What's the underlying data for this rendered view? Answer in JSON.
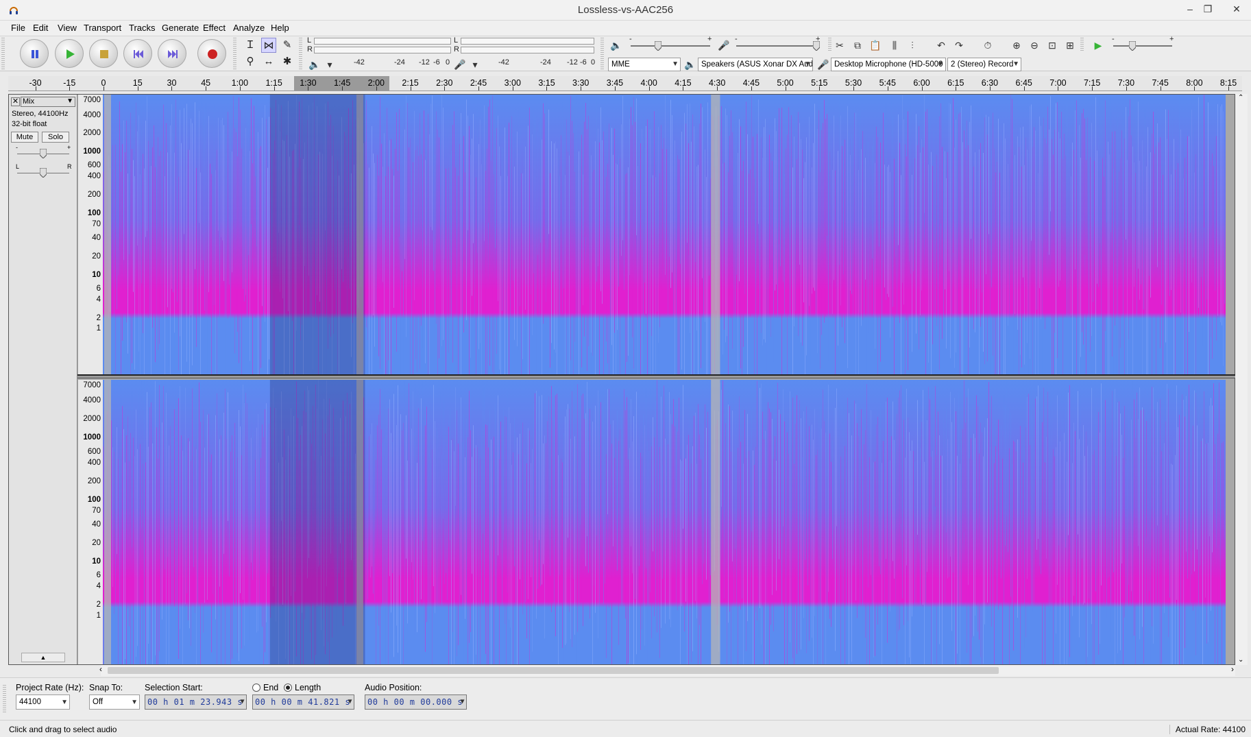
{
  "window": {
    "title": "Lossless-vs-AAC256",
    "minimize": "–",
    "maximize": "❐",
    "close": "✕"
  },
  "menu": [
    {
      "label": "File",
      "ul": "F",
      "rest": "ile"
    },
    {
      "label": "Edit",
      "ul": "E",
      "rest": "dit"
    },
    {
      "label": "View",
      "ul": "V",
      "rest": "iew"
    },
    {
      "label": "Transport",
      "ul": "T",
      "rest": "ransport"
    },
    {
      "label": "Tracks",
      "ul": "T",
      "rest": "racks"
    },
    {
      "label": "Generate",
      "ul": "G",
      "rest": "enerate"
    },
    {
      "label": "Effect",
      "ul": "c",
      "pre": "Effe",
      "rest": "t"
    },
    {
      "label": "Analyze",
      "ul": "A",
      "rest": "nalyze"
    },
    {
      "label": "Help",
      "ul": "H",
      "rest": "elp"
    }
  ],
  "meters": {
    "play_channels": [
      "L",
      "R"
    ],
    "play_scale": [
      "-42",
      "-24",
      "-12",
      "-6",
      "0"
    ],
    "rec_scale": [
      "-42",
      "-24",
      "-12",
      "-6",
      "0"
    ]
  },
  "mixer": {
    "minus": "-",
    "plus": "+"
  },
  "devices": {
    "host": "MME",
    "output": "Speakers (ASUS Xonar DX Aud",
    "input": "Desktop Microphone (HD-5000",
    "channels": "2 (Stereo) Record"
  },
  "ruler": {
    "labels": [
      "-30",
      "-15",
      "0",
      "15",
      "30",
      "45",
      "1:00",
      "1:15",
      "1:30",
      "1:45",
      "2:00",
      "2:15",
      "2:30",
      "2:45",
      "3:00",
      "3:15",
      "3:30",
      "3:45",
      "4:00",
      "4:15",
      "4:30",
      "4:45",
      "5:00",
      "5:15",
      "5:30",
      "5:45",
      "6:00",
      "6:15",
      "6:30",
      "6:45",
      "7:00",
      "7:15",
      "7:30",
      "7:45",
      "8:00",
      "8:15"
    ],
    "selection_start_s": 83.943,
    "selection_length_s": 41.821
  },
  "track": {
    "close": "✕",
    "name": "Mix",
    "format": "Stereo, 44100Hz",
    "sample_format": "32-bit float",
    "mute_label": "Mute",
    "solo_label": "Solo",
    "gain_min": "-",
    "gain_max": "+",
    "pan_left": "L",
    "pan_right": "R",
    "collapse": "▲",
    "freq_labels": [
      {
        "text": "7000",
        "bold": false
      },
      {
        "text": "4000",
        "bold": false
      },
      {
        "text": "2000",
        "bold": false
      },
      {
        "text": "1000",
        "bold": true
      },
      {
        "text": "600",
        "bold": false
      },
      {
        "text": "400",
        "bold": false
      },
      {
        "text": "200",
        "bold": false
      },
      {
        "text": "100",
        "bold": true
      },
      {
        "text": "70",
        "bold": false
      },
      {
        "text": "40",
        "bold": false
      },
      {
        "text": "20",
        "bold": false
      },
      {
        "text": "10",
        "bold": true
      },
      {
        "text": "6",
        "bold": false
      },
      {
        "text": "4",
        "bold": false
      },
      {
        "text": "2",
        "bold": false
      },
      {
        "text": "1",
        "bold": false
      }
    ]
  },
  "selection_toolbar": {
    "project_rate_label": "Project Rate (Hz):",
    "project_rate": "44100",
    "snap_to_label": "Snap To:",
    "snap_to": "Off",
    "selection_start_label": "Selection Start:",
    "end_label": "End",
    "length_label": "Length",
    "selection_start": "00 h 01 m 23.943 s",
    "selection_length": "00 h 00 m 41.821 s",
    "audio_position_label": "Audio Position:",
    "audio_position": "00 h 00 m 00.000 s"
  },
  "status": {
    "message": "Click and drag to select audio",
    "actual_rate": "Actual Rate: 44100"
  },
  "colors": {
    "spectrum_low": "#5b8cf0",
    "spectrum_mid": "#7a66ea",
    "spectrum_high": "#e020d0",
    "silence": "#b5b5b5",
    "selection": "#8a8a8a"
  }
}
